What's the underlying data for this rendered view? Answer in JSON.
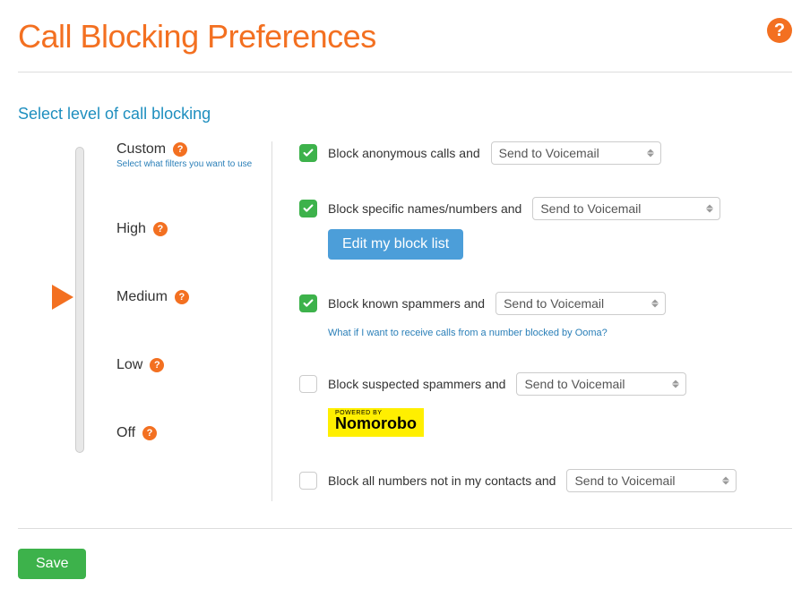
{
  "page_title": "Call Blocking Preferences",
  "section_title": "Select level of call blocking",
  "slider": {
    "selected": "Medium",
    "levels": {
      "custom": {
        "label": "Custom",
        "sub": "Select what filters you want to use"
      },
      "high": {
        "label": "High"
      },
      "medium": {
        "label": "Medium"
      },
      "low": {
        "label": "Low"
      },
      "off": {
        "label": "Off"
      }
    }
  },
  "filters": {
    "anonymous": {
      "checked": true,
      "text": "Block anonymous calls and",
      "action": "Send to Voicemail"
    },
    "specific": {
      "checked": true,
      "text": "Block specific names/numbers and",
      "action": "Send to Voicemail",
      "button": "Edit my block list"
    },
    "known_spammers": {
      "checked": true,
      "text": "Block known spammers and",
      "action": "Send to Voicemail",
      "link": "What if I want to receive calls from a number blocked by Ooma?"
    },
    "suspected_spammers": {
      "checked": false,
      "text": "Block suspected spammers and",
      "action": "Send to Voicemail",
      "powered_by": "POWERED BY",
      "powered_name": "Nomorobo"
    },
    "not_in_contacts": {
      "checked": false,
      "text": "Block all numbers not in my contacts and",
      "action": "Send to Voicemail"
    }
  },
  "select_options": [
    "Send to Voicemail"
  ],
  "save_button": "Save"
}
